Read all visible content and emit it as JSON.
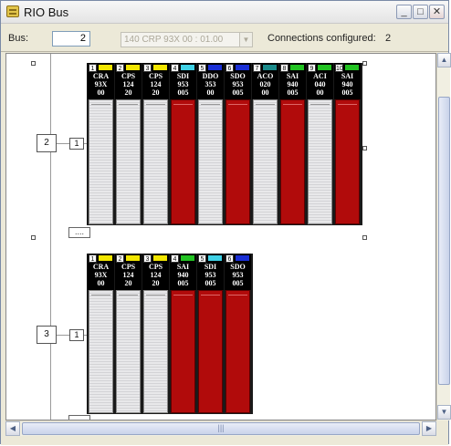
{
  "window": {
    "title": "RIO Bus",
    "minimize_glyph": "_",
    "maximize_glyph": "□",
    "close_glyph": "✕"
  },
  "toolbar": {
    "bus_label": "Bus:",
    "bus_value": "2",
    "cpu_select_value": "140 CRP 93X 00 : 01.00",
    "connections_label": "Connections configured:",
    "connections_value": "2"
  },
  "scrollbars": {
    "up": "▲",
    "down": "▼",
    "left": "◀",
    "right": "▶",
    "h_grip": "|||"
  },
  "drops": [
    {
      "drop_number": "2",
      "rack_number": "1",
      "tag": "....",
      "modules": [
        {
          "slot": "1",
          "led": "#f2e600",
          "line1": "CRA",
          "line2": "93X",
          "line3": "00",
          "fault": false
        },
        {
          "slot": "2",
          "led": "#f2e600",
          "line1": "CPS",
          "line2": "124",
          "line3": "20",
          "fault": false
        },
        {
          "slot": "3",
          "led": "#f2e600",
          "line1": "CPS",
          "line2": "124",
          "line3": "20",
          "fault": false
        },
        {
          "slot": "4",
          "led": "#3fd1e6",
          "line1": "SDI",
          "line2": "953",
          "line3": "005",
          "fault": true
        },
        {
          "slot": "5",
          "led": "#1a2fd6",
          "line1": "DDO",
          "line2": "353",
          "line3": "00",
          "fault": false
        },
        {
          "slot": "6",
          "led": "#1a2fd6",
          "line1": "SDO",
          "line2": "953",
          "line3": "005",
          "fault": true
        },
        {
          "slot": "7",
          "led": "#1a8a8a",
          "line1": "ACO",
          "line2": "020",
          "line3": "00",
          "fault": false
        },
        {
          "slot": "8",
          "led": "#22c322",
          "line1": "SAI",
          "line2": "940",
          "line3": "005",
          "fault": true
        },
        {
          "slot": "9",
          "led": "#22c322",
          "line1": "ACI",
          "line2": "040",
          "line3": "00",
          "fault": false
        },
        {
          "slot": "10",
          "led": "#22c322",
          "line1": "SAI",
          "line2": "940",
          "line3": "005",
          "fault": true
        }
      ]
    },
    {
      "drop_number": "3",
      "rack_number": "1",
      "tag": "....",
      "modules": [
        {
          "slot": "1",
          "led": "#f2e600",
          "line1": "CRA",
          "line2": "93X",
          "line3": "00",
          "fault": false
        },
        {
          "slot": "2",
          "led": "#f2e600",
          "line1": "CPS",
          "line2": "124",
          "line3": "20",
          "fault": false
        },
        {
          "slot": "3",
          "led": "#f2e600",
          "line1": "CPS",
          "line2": "124",
          "line3": "20",
          "fault": false
        },
        {
          "slot": "4",
          "led": "#22c322",
          "line1": "SAI",
          "line2": "940",
          "line3": "005",
          "fault": true
        },
        {
          "slot": "5",
          "led": "#3fd1e6",
          "line1": "SDI",
          "line2": "953",
          "line3": "005",
          "fault": true
        },
        {
          "slot": "6",
          "led": "#1a2fd6",
          "line1": "SDO",
          "line2": "953",
          "line3": "005",
          "fault": true
        }
      ]
    }
  ]
}
